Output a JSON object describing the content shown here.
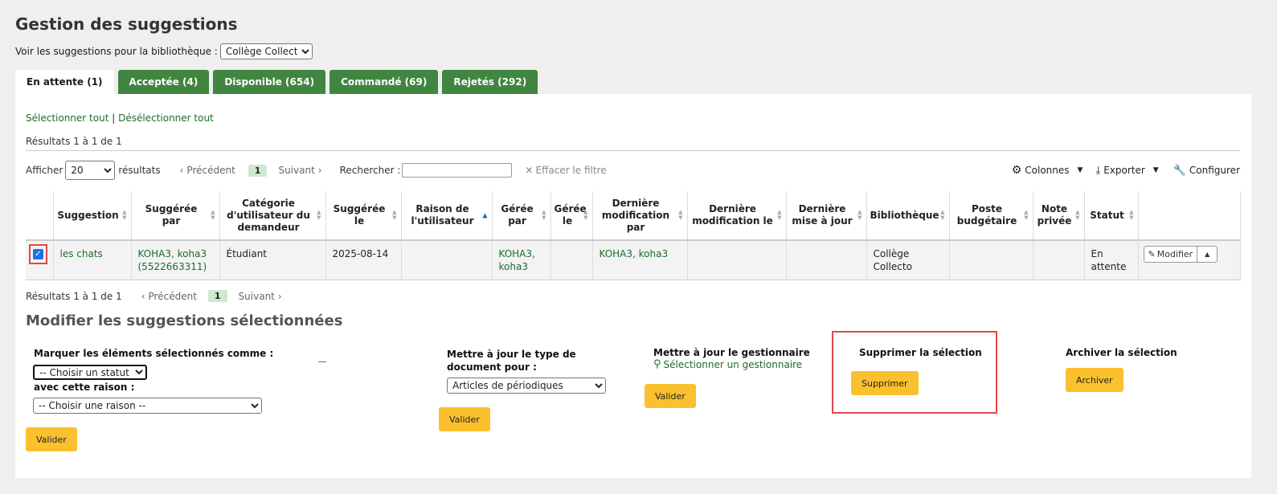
{
  "page": {
    "title": "Gestion des suggestions",
    "library_label": "Voir les suggestions pour la bibliothèque :",
    "library_value": "Collège Collecto"
  },
  "tabs": [
    {
      "label": "En attente (1)",
      "active": true
    },
    {
      "label": "Acceptée (4)",
      "active": false
    },
    {
      "label": "Disponible (654)",
      "active": false
    },
    {
      "label": "Commandé (69)",
      "active": false
    },
    {
      "label": "Rejetés (292)",
      "active": false
    }
  ],
  "selection": {
    "select_all": "Sélectionner tout",
    "separator": "|",
    "deselect_all": "Désélectionner tout"
  },
  "results_top": "Résultats 1 à 1 de 1",
  "toolbar": {
    "show_label": "Afficher",
    "show_value": "20",
    "results_label": "résultats",
    "prev": "Précédent",
    "page": "1",
    "next": "Suivant",
    "search_label": "Rechercher :",
    "clear_filter": "Effacer le filtre",
    "columns": "Colonnes",
    "export": "Exporter",
    "configure": "Configurer"
  },
  "table": {
    "headers": [
      "Suggestion",
      "Suggérée par",
      "Catégorie d'utilisateur du demandeur",
      "Suggérée le",
      "Raison de l'utilisateur",
      "Gérée par",
      "Gérée le",
      "Dernière modification par",
      "Dernière modification le",
      "Dernière mise à jour",
      "Bibliothèque",
      "Poste budgétaire",
      "Note privée",
      "Statut"
    ],
    "row": {
      "suggestion": "les chats",
      "suggested_by": "KOHA3, koha3 (5522663311)",
      "category": "Étudiant",
      "suggested_on": "2025-08-14",
      "reason": "",
      "managed_by": "KOHA3, koha3",
      "managed_on": "",
      "last_modified_by": "KOHA3, koha3",
      "last_modified_on": "",
      "last_update": "",
      "library": "Collège Collecto",
      "budget": "",
      "private_note": "",
      "status": "En attente",
      "edit_label": "Modifier"
    }
  },
  "bottom_pager": {
    "results": "Résultats 1 à 1 de 1",
    "prev": "Précédent",
    "page": "1",
    "next": "Suivant"
  },
  "modify": {
    "title": "Modifier les suggestions sélectionnées",
    "mark_label": "Marquer les éléments sélectionnés comme :",
    "status_placeholder": "-- Choisir un statut --",
    "reason_label": "avec cette raison :",
    "reason_placeholder": "-- Choisir une raison --",
    "validate": "Valider",
    "doctype_label": "Mettre à jour le type de document pour :",
    "doctype_value": "Articles de périodiques",
    "manager_label": "Mettre à jour le gestionnaire",
    "select_manager": "Sélectionner un gestionnaire",
    "delete_label": "Supprimer la sélection",
    "delete_btn": "Supprimer",
    "archive_label": "Archiver la sélection",
    "archive_btn": "Archiver"
  }
}
